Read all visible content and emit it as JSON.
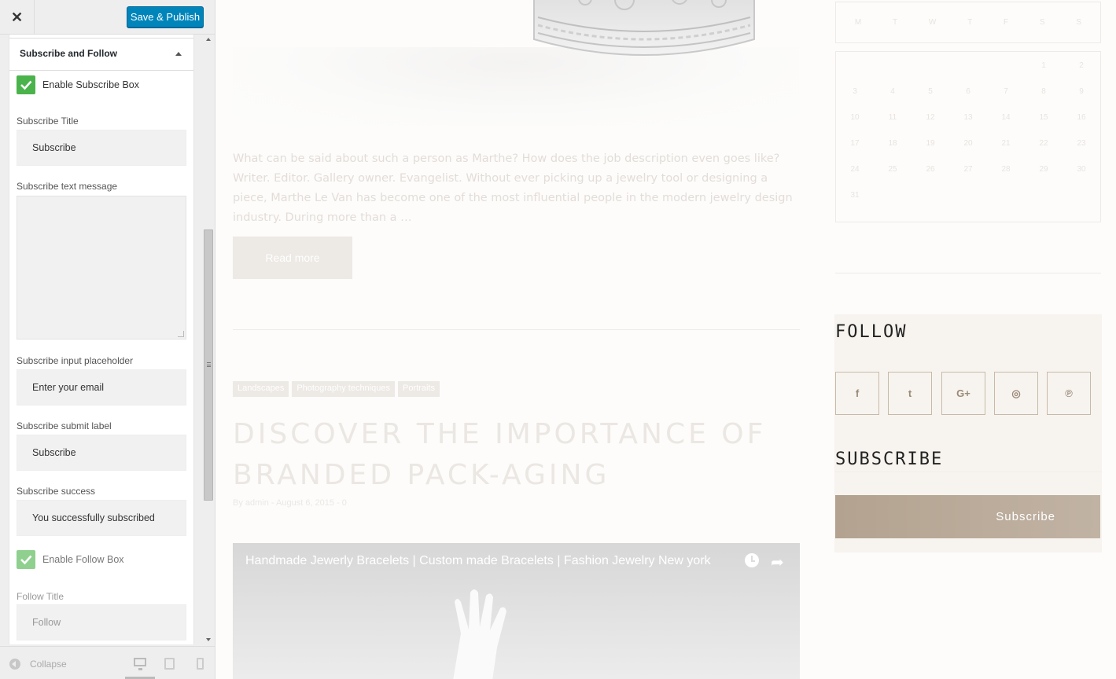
{
  "panel": {
    "close_glyph": "✕",
    "save_label": "Save & Publish",
    "section_title": "Subscribe and Follow",
    "enable_subscribe_label": "Enable Subscribe Box",
    "subscribe_title_label": "Subscribe Title",
    "subscribe_title_value": "Subscribe",
    "subscribe_text_label": "Subscribe text message",
    "subscribe_text_value": "",
    "placeholder_label": "Subscribe input placeholder",
    "placeholder_value": "Enter your email",
    "submit_label_label": "Subscribe submit label",
    "submit_label_value": "Subscribe",
    "success_label": "Subscribe success",
    "success_value": "You successfully subscribed",
    "enable_follow_label": "Enable Follow Box",
    "follow_title_label": "Follow Title",
    "follow_title_value": "Follow",
    "collapse_label": "Collapse"
  },
  "preview": {
    "excerpt": "What can be said about such a person as Marthe? How does the job description even goes like? Writer. Editor. Gallery owner. Evangelist. Without ever picking up a jewelry tool or designing a piece, Marthe Le Van has become one of the most influential people in the modern jewelry design industry. During more than a …",
    "read_more": "Read more",
    "tags": [
      "Landscapes",
      "Photography techniques",
      "Portraits"
    ],
    "post_title": "DISCOVER THE IMPORTANCE OF BRANDED PACK-AGING",
    "post_meta": "By admin - August 6, 2015 - 0",
    "video_title": "Handmade Jewerly Bracelets | Custom made Bracelets | Fashion Jewelry New york",
    "calendar_days": [
      "M",
      "T",
      "W",
      "T",
      "F",
      "S",
      "S"
    ],
    "calendar_dates": [
      "",
      "",
      "",
      "",
      "",
      "1",
      "2",
      "3",
      "4",
      "5",
      "6",
      "7",
      "8",
      "9",
      "10",
      "11",
      "12",
      "13",
      "14",
      "15",
      "16",
      "17",
      "18",
      "19",
      "20",
      "21",
      "22",
      "23",
      "24",
      "25",
      "26",
      "27",
      "28",
      "29",
      "30",
      "31",
      "",
      "",
      "",
      "",
      "",
      ""
    ],
    "follow_title": "FOLLOW",
    "subscribe_title": "SUBSCRIBE",
    "subscribe_button": "Subscribe",
    "social_icons": [
      "facebook-icon",
      "twitter-icon",
      "google-plus-icon",
      "instagram-icon",
      "pinterest-icon"
    ],
    "social_glyphs": [
      "f",
      "t",
      "G+",
      "◎",
      "℗"
    ]
  },
  "colors": {
    "accent": "#0085ba",
    "checkbox": "#4bb34b",
    "subscribe_button": "#b3a28f",
    "follow_box": "#f7f4ef"
  }
}
